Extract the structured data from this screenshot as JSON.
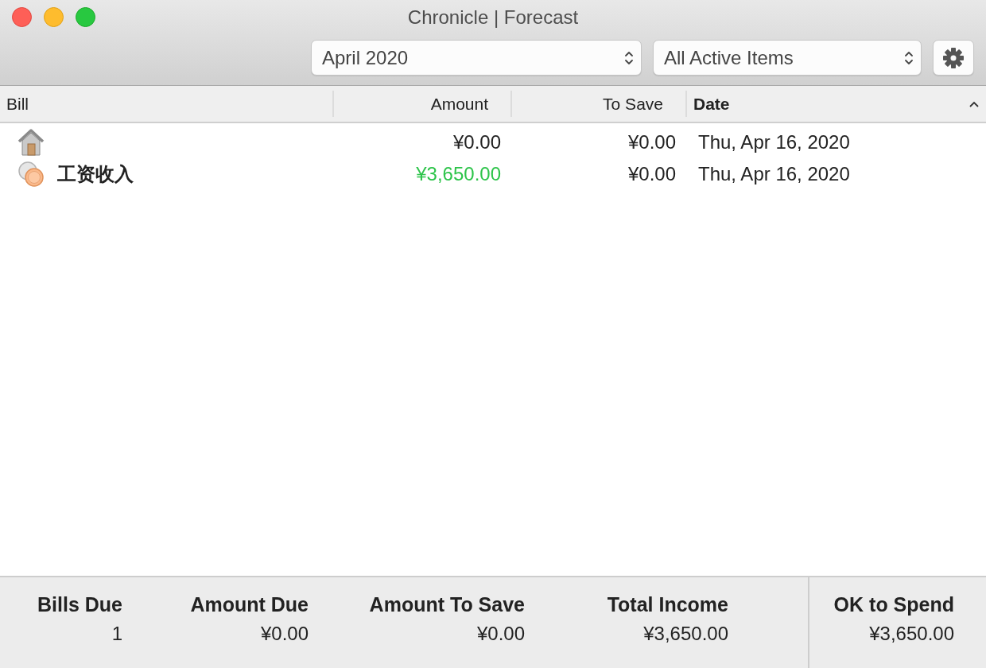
{
  "window": {
    "title": "Chronicle | Forecast"
  },
  "toolbar": {
    "period": "April 2020",
    "filter": "All Active Items"
  },
  "table": {
    "columns": [
      {
        "label": "Bill",
        "sorted": false
      },
      {
        "label": "Amount",
        "sorted": false
      },
      {
        "label": "To Save",
        "sorted": false
      },
      {
        "label": "Date",
        "sorted": true
      }
    ],
    "rows": [
      {
        "kind": "bill",
        "amount": "¥0.00",
        "to_save": "¥0.00",
        "date": "Thu, Apr 16, 2020"
      },
      {
        "kind": "income",
        "name": "工资收入",
        "amount": "¥3,650.00",
        "to_save": "¥0.00",
        "date": "Thu, Apr 16, 2020"
      }
    ]
  },
  "summary": [
    {
      "label": "Bills Due",
      "value": "1"
    },
    {
      "label": "Amount Due",
      "value": "¥0.00"
    },
    {
      "label": "Amount To Save",
      "value": "¥0.00"
    },
    {
      "label": "Total Income",
      "value": "¥3,650.00"
    }
  ],
  "ok_to_spend": {
    "label": "OK to Spend",
    "value": "¥3,650.00"
  }
}
